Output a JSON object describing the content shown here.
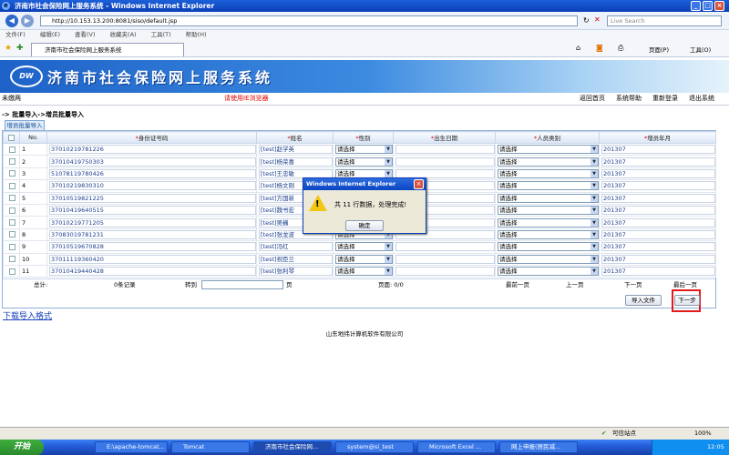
{
  "window": {
    "title": "济南市社会保险网上服务系统 - Windows Internet Explorer"
  },
  "browser": {
    "address": "http://10.153.13.200:8081/siso/default.jsp",
    "search_placeholder": "Live Search",
    "menu": [
      "文件(F)",
      "编辑(E)",
      "查看(V)",
      "收藏夹(A)",
      "工具(T)",
      "帮助(H)"
    ],
    "tab_label": "济南市社会保险网上服务系统",
    "page_menu": "页面(P)",
    "tools_menu": "工具(O)"
  },
  "banner": {
    "logo": "DW",
    "title": "济南市社会保险网上服务系统"
  },
  "nav": {
    "left_text": "未缴两",
    "notice": "请使用IE浏览器",
    "links": [
      "返回首页",
      "系统帮助",
      "重新登录",
      "退出系统"
    ]
  },
  "breadcrumb": "-> 批量导入->增员批量导入",
  "subtab": "增员批量导入",
  "table": {
    "headers": {
      "no": "No.",
      "id": "身份证号码",
      "name": "姓名",
      "gender": "性别",
      "birth": "出生日期",
      "category": "人员类别",
      "month": "增员年月"
    },
    "rows": [
      {
        "no": "1",
        "id": "37010219781226",
        "name": "[test]赵学英",
        "gender": "请选择",
        "category": "请选择",
        "month": "201307"
      },
      {
        "no": "2",
        "id": "37010419750303",
        "name": "[test]杨荣喜",
        "gender": "请选择",
        "category": "请选择",
        "month": "201307"
      },
      {
        "no": "3",
        "id": "51078119780426",
        "name": "[test]王忠敏",
        "gender": "请选择",
        "category": "请选择",
        "month": "201307"
      },
      {
        "no": "4",
        "id": "37010219830310",
        "name": "[test]杨文刚",
        "gender": "请选择",
        "category": "请选择",
        "month": "201307"
      },
      {
        "no": "5",
        "id": "37010519821225",
        "name": "[test]方国新",
        "gender": "请选择",
        "category": "请选择",
        "month": "201307"
      },
      {
        "no": "6",
        "id": "37010419640515",
        "name": "[test]魏书宏",
        "gender": "请选择",
        "category": "请选择",
        "month": "201307"
      },
      {
        "no": "7",
        "id": "37010219771205",
        "name": "[test]吴巍",
        "gender": "请选择",
        "category": "请选择",
        "month": "201307"
      },
      {
        "no": "8",
        "id": "37083019781231",
        "name": "[test]张龙波",
        "gender": "请选择",
        "category": "请选择",
        "month": "201307"
      },
      {
        "no": "9",
        "id": "37010519670828",
        "name": "[test]冯红",
        "gender": "请选择",
        "category": "请选择",
        "month": "201307"
      },
      {
        "no": "10",
        "id": "37011119360420",
        "name": "[test]祝臣兰",
        "gender": "请选择",
        "category": "请选择",
        "month": "201307"
      },
      {
        "no": "11",
        "id": "37010419440428",
        "name": "[test]张利琴",
        "gender": "请选择",
        "category": "请选择",
        "month": "201307"
      }
    ]
  },
  "pager": {
    "total": "总计:",
    "records": "0条记录",
    "goto": "转到",
    "page_unit": "页",
    "page_label": "页面: 0/0",
    "first": "最前一页",
    "prev": "上一页",
    "next": "下一页",
    "last": "最后一页"
  },
  "actions": {
    "import": "导入文件",
    "next_step": "下一步"
  },
  "download_link": "下载导入格式",
  "footer": "山东地纬计算机软件有限公司",
  "dialog": {
    "title": "Windows Internet Explorer",
    "message": "共 11 行数据，处理完成!",
    "ok": "确定"
  },
  "statusbar": {
    "zone": "可信站点",
    "zoom": "100%"
  },
  "taskbar": {
    "start": "开始",
    "items": [
      "E:\\apache-tomcat...",
      "Tomcat",
      "济南市社会保险网...",
      "system@si_test",
      "Microsoft Excel ...",
      "网上申报(居民减..."
    ],
    "clock": "12:05"
  }
}
